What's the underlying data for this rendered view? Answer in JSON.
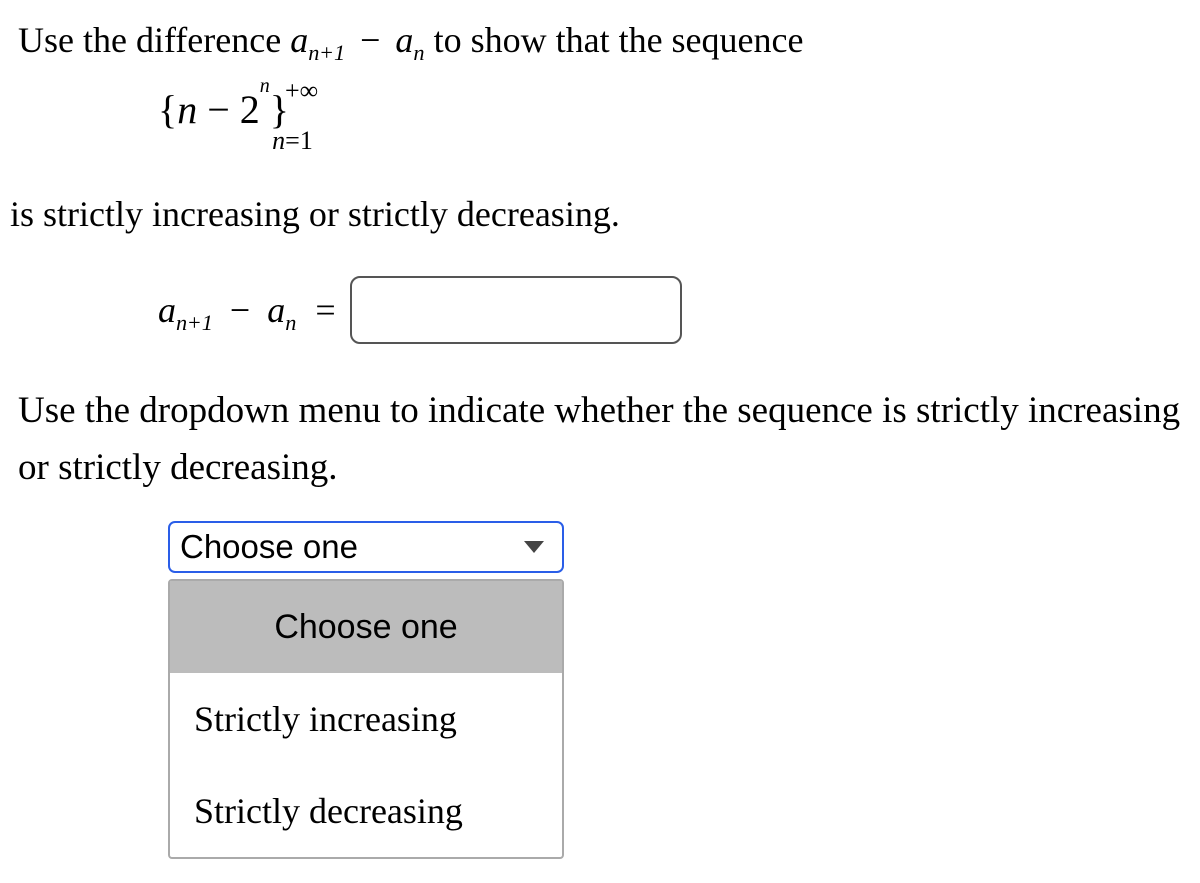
{
  "problem": {
    "line1_prefix": "Use the difference ",
    "line1_suffix": " to show that the sequence",
    "a_symbol": "a",
    "sub_n": "n",
    "sub_nplus1_n": "n",
    "sub_nplus1_plus": "+",
    "sub_nplus1_one": "1",
    "minus": "−",
    "sequence": {
      "open_brace": "{",
      "n": "n",
      "minus": " − ",
      "two": "2",
      "exp_n": "n",
      "close_brace": "}",
      "top": "+∞",
      "bottom_n": "n",
      "bottom_eq": "=",
      "bottom_one": "1"
    },
    "line2": "is strictly increasing or strictly decreasing.",
    "equals": "="
  },
  "answer_input": {
    "value": "",
    "placeholder": ""
  },
  "instruction2": "Use the dropdown menu to indicate whether the sequence is strictly increasing or strictly decreasing.",
  "dropdown": {
    "selected": "Choose one",
    "options": [
      "Choose one",
      "Strictly increasing",
      "Strictly decreasing"
    ]
  }
}
